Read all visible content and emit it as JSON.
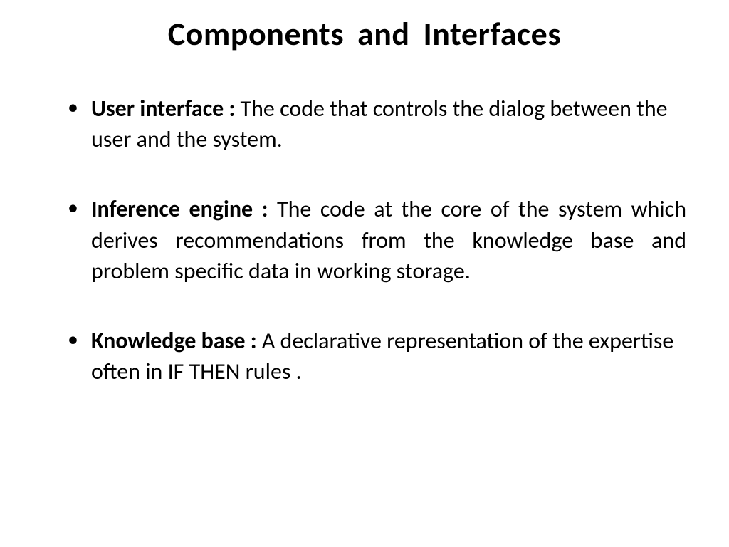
{
  "slide": {
    "title": "Components  and  Interfaces",
    "bullets": [
      {
        "term": "User interface : ",
        "description": "The  code that controls the dialog between the user and  the  system.",
        "justified": false
      },
      {
        "term": "Inference engine : ",
        "description": "The code at the core of the system which derives recommendations from the knowledge base and problem specific  data  in working  storage.",
        "justified": true
      },
      {
        "term": "Knowledge base : ",
        "description": "A declarative representation of the expertise  often  in  IF THEN  rules .",
        "justified": false
      }
    ]
  }
}
